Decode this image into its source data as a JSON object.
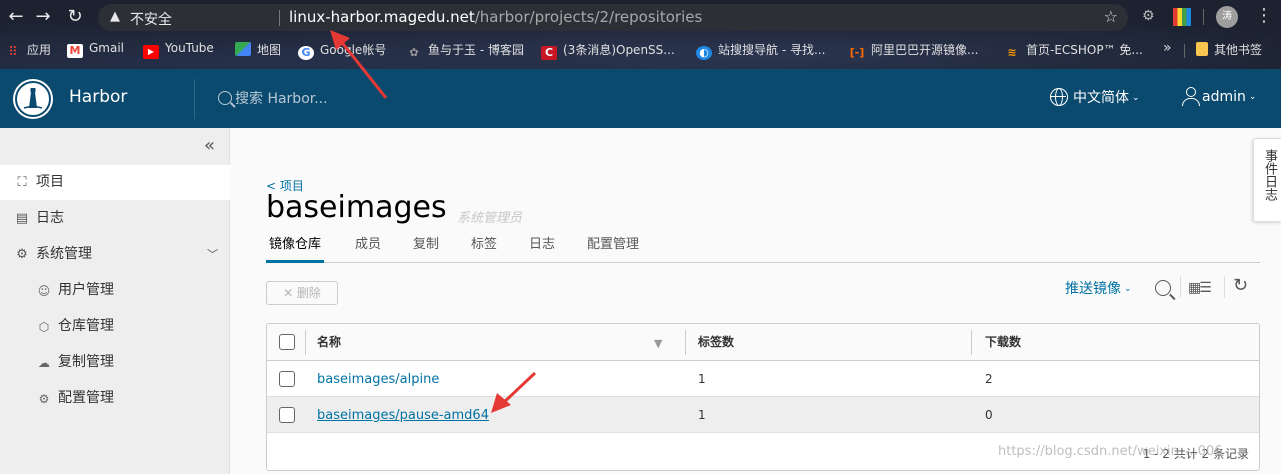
{
  "browser": {
    "back_icon": "arrow-left-icon",
    "forward_icon": "arrow-right-icon",
    "reload_icon": "reload-icon",
    "security_label": "不安全",
    "url_host": "linux-harbor.magedu.net",
    "url_path": "/harbor/projects/2/repositories",
    "profile_initial": "涛",
    "bookmarks": [
      {
        "label": "应用",
        "icon": "apps-grid-icon",
        "color": "#ea4335"
      },
      {
        "label": "Gmail",
        "icon": "gmail-icon",
        "color": "#ea4335"
      },
      {
        "label": "YouTube",
        "icon": "youtube-icon",
        "color": "#ff0000"
      },
      {
        "label": "地图",
        "icon": "maps-icon",
        "color": "#34a853"
      },
      {
        "label": "Google帐号",
        "icon": "google-icon",
        "color": "#4285f4"
      },
      {
        "label": "鱼与于玉 - 博客园",
        "icon": "blog-icon",
        "color": "#666666"
      },
      {
        "label": "(3条消息)OpenSS...",
        "icon": "csdn-icon",
        "color": "#c81623"
      },
      {
        "label": "站搜搜导航 - 寻找...",
        "icon": "compass-icon",
        "color": "#1e88e5"
      },
      {
        "label": "阿里巴巴开源镜像...",
        "icon": "aliyun-icon",
        "color": "#ff6a00"
      },
      {
        "label": "首页-ECSHOP™ 免...",
        "icon": "ecshop-icon",
        "color": "#ff9800"
      }
    ],
    "bookmarks_more": "»",
    "other_bookmarks": "其他书签"
  },
  "header": {
    "brand": "Harbor",
    "search_placeholder": "搜索 Harbor...",
    "language": "中文简体",
    "user": "admin"
  },
  "sidebar": {
    "collapse_icon": "double-chevron-left-icon",
    "items": [
      {
        "label": "项目",
        "icon": "projects-icon",
        "active": true
      },
      {
        "label": "日志",
        "icon": "logs-icon",
        "active": false
      },
      {
        "label": "系统管理",
        "icon": "admin-icon",
        "active": false,
        "expanded": true
      }
    ],
    "subitems": [
      {
        "label": "用户管理",
        "icon": "users-icon"
      },
      {
        "label": "仓库管理",
        "icon": "registry-cube-icon"
      },
      {
        "label": "复制管理",
        "icon": "cloud-replication-icon"
      },
      {
        "label": "配置管理",
        "icon": "gear-icon"
      }
    ]
  },
  "main": {
    "back_link": "< 项目",
    "project_name": "baseimages",
    "role": "系统管理员",
    "tabs": [
      {
        "label": "镜像仓库",
        "active": true
      },
      {
        "label": "成员",
        "active": false
      },
      {
        "label": "复制",
        "active": false
      },
      {
        "label": "标签",
        "active": false
      },
      {
        "label": "日志",
        "active": false
      },
      {
        "label": "配置管理",
        "active": false
      }
    ],
    "delete_button": "✕ 删除",
    "push_image": "推送镜像",
    "table": {
      "columns": [
        "名称",
        "标签数",
        "下载数"
      ],
      "rows": [
        {
          "name": "baseimages/alpine",
          "tags": "1",
          "downloads": "2"
        },
        {
          "name": "baseimages/pause-amd64",
          "tags": "1",
          "downloads": "0"
        }
      ],
      "footer": "1 - 2 共计 2 条记录"
    }
  },
  "event_log_tab": "事件日志",
  "watermark": "https://blog.csdn.net/weixin_...006",
  "colors": {
    "header_bg": "#0b4a6f",
    "link": "#0072a3",
    "annotation_arrow": "#e53935"
  }
}
